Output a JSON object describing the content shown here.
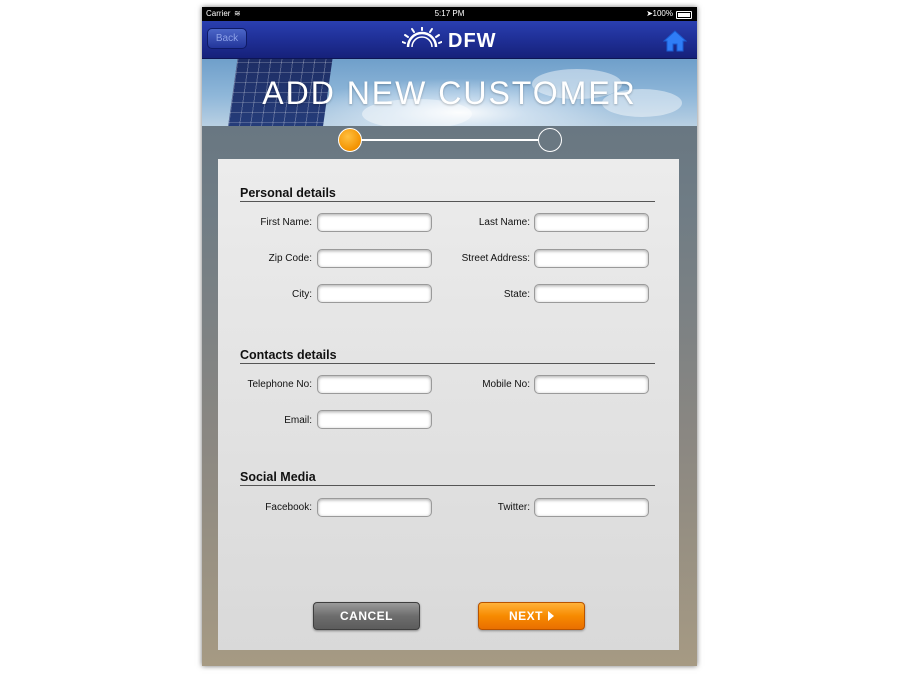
{
  "status_bar": {
    "carrier": "Carrier",
    "time": "5:17 PM",
    "battery": "100%"
  },
  "nav": {
    "back_label": "Back",
    "logo_text": "DFW"
  },
  "hero": {
    "title": "ADD NEW CUSTOMER"
  },
  "wizard": {
    "current_step": 1,
    "total_steps": 2
  },
  "form": {
    "personal": {
      "title": "Personal details",
      "first_name_label": "First Name:",
      "last_name_label": "Last Name:",
      "zip_label": "Zip Code:",
      "street_label": "Street Address:",
      "city_label": "City:",
      "state_label": "State:"
    },
    "contacts": {
      "title": "Contacts details",
      "telephone_label": "Telephone No:",
      "mobile_label": "Mobile No:",
      "email_label": "Email:"
    },
    "social": {
      "title": "Social Media",
      "facebook_label": "Facebook:",
      "twitter_label": "Twitter:"
    }
  },
  "buttons": {
    "cancel": "CANCEL",
    "next": "NEXT"
  },
  "colors": {
    "nav_blue": "#1f2f96",
    "accent_orange": "#f78a00",
    "cancel_gray": "#6d6d6d"
  }
}
